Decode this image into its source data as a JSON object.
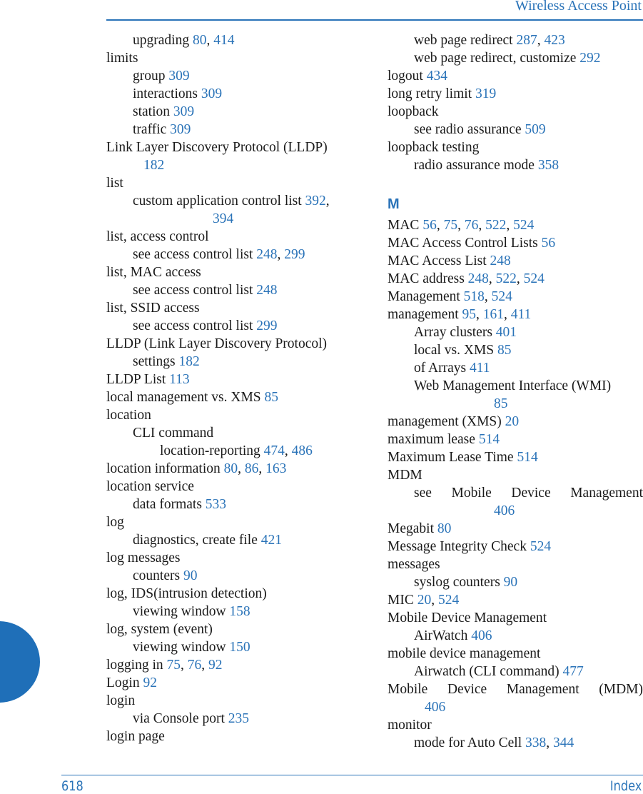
{
  "header": {
    "title": "Wireless Access Point"
  },
  "footer": {
    "page_number": "618",
    "section": "Index"
  },
  "left_column": [
    {
      "level": 1,
      "term": "upgrading",
      "pages": [
        "80",
        "414"
      ]
    },
    {
      "level": 0,
      "term": "limits",
      "pages": []
    },
    {
      "level": 1,
      "term": "group",
      "pages": [
        "309"
      ]
    },
    {
      "level": 1,
      "term": "interactions",
      "pages": [
        "309"
      ]
    },
    {
      "level": 1,
      "term": "station",
      "pages": [
        "309"
      ]
    },
    {
      "level": 1,
      "term": "traffic",
      "pages": [
        "309"
      ]
    },
    {
      "level": 0,
      "term": "Link Layer Discovery Protocol (LLDP)",
      "pages": [
        "182"
      ],
      "wrap_pages": true
    },
    {
      "level": 0,
      "term": "list",
      "pages": []
    },
    {
      "level": 1,
      "term": "custom application control list",
      "pages": [
        "392",
        "394"
      ],
      "wrap_after": 1
    },
    {
      "level": 0,
      "term": "list, access control",
      "pages": []
    },
    {
      "level": 1,
      "term": "see access control list",
      "pages": [
        "248",
        "299"
      ]
    },
    {
      "level": 0,
      "term": "list, MAC access",
      "pages": []
    },
    {
      "level": 1,
      "term": "see access control list",
      "pages": [
        "248"
      ]
    },
    {
      "level": 0,
      "term": "list, SSID access",
      "pages": []
    },
    {
      "level": 1,
      "term": "see access control list",
      "pages": [
        "299"
      ]
    },
    {
      "level": 0,
      "term": "LLDP (Link Layer Discovery Protocol)",
      "pages": []
    },
    {
      "level": 1,
      "term": "settings",
      "pages": [
        "182"
      ]
    },
    {
      "level": 0,
      "term": "LLDP List",
      "pages": [
        "113"
      ]
    },
    {
      "level": 0,
      "term": "local management vs. XMS",
      "pages": [
        "85"
      ]
    },
    {
      "level": 0,
      "term": "location",
      "pages": []
    },
    {
      "level": 1,
      "term": "CLI command",
      "pages": []
    },
    {
      "level": 2,
      "term": "location-reporting",
      "pages": [
        "474",
        "486"
      ]
    },
    {
      "level": 0,
      "term": "location information",
      "pages": [
        "80",
        "86",
        "163"
      ]
    },
    {
      "level": 0,
      "term": "location service",
      "pages": []
    },
    {
      "level": 1,
      "term": "data formats",
      "pages": [
        "533"
      ]
    },
    {
      "level": 0,
      "term": "log",
      "pages": []
    },
    {
      "level": 1,
      "term": "diagnostics, create file",
      "pages": [
        "421"
      ]
    },
    {
      "level": 0,
      "term": "log messages",
      "pages": []
    },
    {
      "level": 1,
      "term": "counters",
      "pages": [
        "90"
      ]
    },
    {
      "level": 0,
      "term": "log, IDS(intrusion detection)",
      "pages": []
    },
    {
      "level": 1,
      "term": "viewing window",
      "pages": [
        "158"
      ]
    },
    {
      "level": 0,
      "term": "log, system (event)",
      "pages": []
    },
    {
      "level": 1,
      "term": "viewing window",
      "pages": [
        "150"
      ]
    },
    {
      "level": 0,
      "term": "logging in",
      "pages": [
        "75",
        "76",
        "92"
      ]
    },
    {
      "level": 0,
      "term": "Login",
      "pages": [
        "92"
      ]
    },
    {
      "level": 0,
      "term": "login",
      "pages": []
    },
    {
      "level": 1,
      "term": "via Console port",
      "pages": [
        "235"
      ]
    },
    {
      "level": 0,
      "term": "login page",
      "pages": []
    }
  ],
  "right_column": [
    {
      "level": 1,
      "term": "web page redirect",
      "pages": [
        "287",
        "423"
      ]
    },
    {
      "level": 1,
      "term": "web page redirect, customize",
      "pages": [
        "292"
      ]
    },
    {
      "level": 0,
      "term": "logout",
      "pages": [
        "434"
      ]
    },
    {
      "level": 0,
      "term": "long retry limit",
      "pages": [
        "319"
      ]
    },
    {
      "level": 0,
      "term": "loopback",
      "pages": []
    },
    {
      "level": 1,
      "term": "see radio assurance",
      "pages": [
        "509"
      ]
    },
    {
      "level": 0,
      "term": "loopback testing",
      "pages": []
    },
    {
      "level": 1,
      "term": "radio assurance mode",
      "pages": [
        "358"
      ]
    },
    {
      "letter": "M"
    },
    {
      "level": 0,
      "term": "MAC",
      "pages": [
        "56",
        "75",
        "76",
        "522",
        "524"
      ]
    },
    {
      "level": 0,
      "term": "MAC Access Control Lists",
      "pages": [
        "56"
      ]
    },
    {
      "level": 0,
      "term": "MAC Access List",
      "pages": [
        "248"
      ]
    },
    {
      "level": 0,
      "term": "MAC address",
      "pages": [
        "248",
        "522",
        "524"
      ]
    },
    {
      "level": 0,
      "term": "Management",
      "pages": [
        "518",
        "524"
      ]
    },
    {
      "level": 0,
      "term": "management",
      "pages": [
        "95",
        "161",
        "411"
      ]
    },
    {
      "level": 1,
      "term": "Array clusters",
      "pages": [
        "401"
      ]
    },
    {
      "level": 1,
      "term": "local vs. XMS",
      "pages": [
        "85"
      ]
    },
    {
      "level": 1,
      "term": "of Arrays",
      "pages": [
        "411"
      ]
    },
    {
      "level": 1,
      "term": "Web Management Interface (WMI)",
      "pages": [
        "85"
      ],
      "wrap_pages": true
    },
    {
      "level": 0,
      "term": "management (XMS)",
      "pages": [
        "20"
      ]
    },
    {
      "level": 0,
      "term": "maximum lease",
      "pages": [
        "514"
      ]
    },
    {
      "level": 0,
      "term": "Maximum Lease Time",
      "pages": [
        "514"
      ]
    },
    {
      "level": 0,
      "term": "MDM",
      "pages": []
    },
    {
      "level": 1,
      "term": "see Mobile Device Management",
      "pages": [
        "406"
      ],
      "wrap_pages": true,
      "justify": true
    },
    {
      "level": 0,
      "term": "Megabit",
      "pages": [
        "80"
      ]
    },
    {
      "level": 0,
      "term": "Message Integrity Check",
      "pages": [
        "524"
      ]
    },
    {
      "level": 0,
      "term": "messages",
      "pages": []
    },
    {
      "level": 1,
      "term": "syslog counters",
      "pages": [
        "90"
      ]
    },
    {
      "level": 0,
      "term": "MIC",
      "pages": [
        "20",
        "524"
      ]
    },
    {
      "level": 0,
      "term": "Mobile Device Management",
      "pages": []
    },
    {
      "level": 1,
      "term": "AirWatch",
      "pages": [
        "406"
      ]
    },
    {
      "level": 0,
      "term": "mobile device management",
      "pages": []
    },
    {
      "level": 1,
      "term": "Airwatch (CLI command)",
      "pages": [
        "477"
      ]
    },
    {
      "level": 0,
      "term": "Mobile Device Management (MDM)",
      "pages": [
        "406"
      ],
      "wrap_pages": true,
      "justify": true
    },
    {
      "level": 0,
      "term": "monitor",
      "pages": []
    },
    {
      "level": 1,
      "term": "mode for Auto Cell",
      "pages": [
        "338",
        "344"
      ]
    }
  ],
  "colors": {
    "accent": "#2a73b8",
    "tab": "#1f6fb8",
    "text": "#1a1a1a"
  }
}
